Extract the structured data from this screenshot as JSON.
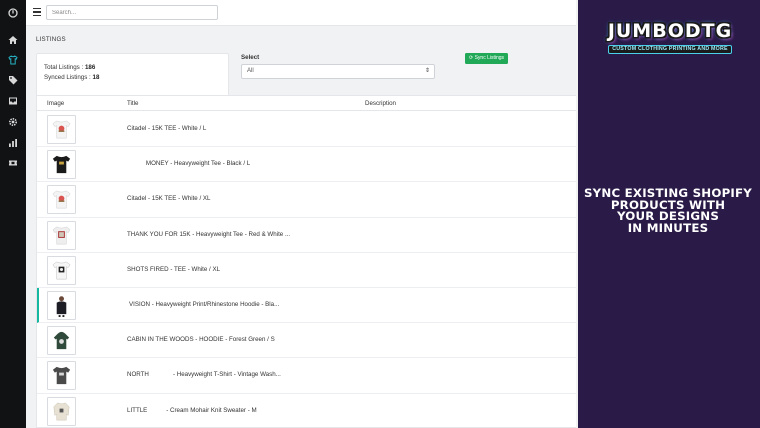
{
  "sidebar": {
    "items": [
      {
        "icon": "power-icon",
        "active": false
      },
      {
        "icon": "home-icon",
        "active": false
      },
      {
        "icon": "shirt-icon",
        "active": true
      },
      {
        "icon": "tag-icon",
        "active": false
      },
      {
        "icon": "inbox-icon",
        "active": false
      },
      {
        "icon": "gear-icon",
        "active": false
      },
      {
        "icon": "bar-chart-icon",
        "active": false
      },
      {
        "icon": "ticket-icon",
        "active": false
      }
    ]
  },
  "topbar": {
    "search_placeholder": "Search..."
  },
  "page": {
    "title": "LISTINGS"
  },
  "stats": {
    "total_label": "Total Listings : ",
    "total_value": "186",
    "synced_label": "Synced Listings : ",
    "synced_value": "18"
  },
  "filter": {
    "label": "Select",
    "selected": "All"
  },
  "sync_button": {
    "label": "⟳ Sync Listings"
  },
  "table": {
    "columns": [
      "Image",
      "Title",
      "Description"
    ],
    "rows": [
      {
        "title": "Citadel - 15K TEE - White / L",
        "thumb": "white-tee"
      },
      {
        "title": "           MONEY - Heavyweight Tee - Black / L",
        "thumb": "black-tee"
      },
      {
        "title": "Citadel - 15K TEE - White / XL",
        "thumb": "white-tee"
      },
      {
        "title": "THANK YOU FOR 15K - Heavyweight Tee - Red & White ...",
        "thumb": "white-print-tee"
      },
      {
        "title": "SHOTS FIRED - TEE - White / XL",
        "thumb": "white-dark-print-tee"
      },
      {
        "title": "VISION - Heavyweight Print/Rhinestone Hoodie - Bla...",
        "thumb": "person-hoodie"
      },
      {
        "title": "CABIN IN THE WOODS - HOODIE - Forest Green / S",
        "thumb": "green-hoodie"
      },
      {
        "title": "NORTH              - Heavyweight T-Shirt - Vintage Wash...",
        "thumb": "gray-tee"
      },
      {
        "title": "LITTLE           - Cream Mohair Knit Sweater - M",
        "thumb": "cream-sweater"
      }
    ]
  },
  "promo": {
    "logo_main": "JUMBODTG",
    "logo_sub": "CUSTOM CLOTHING PRINTING AND MORE",
    "lines": [
      "Sync existing Shopify",
      "products with",
      "your designs",
      "in minutes"
    ],
    "bg_color": "#2a1a47"
  }
}
